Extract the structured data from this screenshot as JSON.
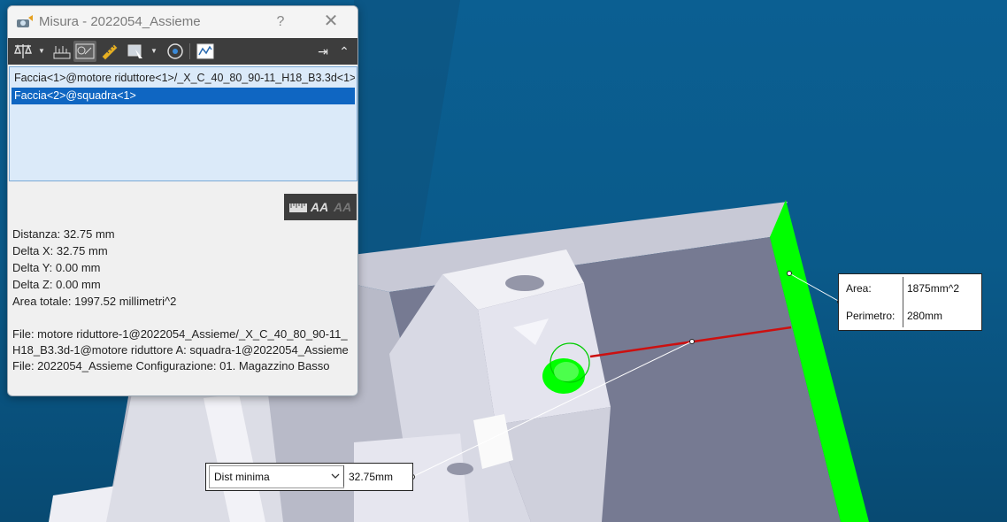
{
  "dialog": {
    "title": "Misura - 2022054_Assieme",
    "help_label": "?",
    "close_label": "✕"
  },
  "selections": [
    "Faccia<1>@motore riduttore<1>/_X_C_40_80_90-11_H18_B3.3d<1>",
    "Faccia<2>@squadra<1>"
  ],
  "results": {
    "distance": "Distanza: 32.75 mm",
    "delta_x": "Delta X: 32.75 mm",
    "delta_y": "Delta Y: 0.00 mm",
    "delta_z": "Delta Z: 0.00 mm",
    "total_area": "Area totale: 1997.52 millimetri^2"
  },
  "files": {
    "file_1": "File: motore riduttore-1@2022054_Assieme/_X_C_40_80_90-11_H18_B3.3d-1@motore riduttore A: squadra-1@2022054_Assieme",
    "file_2": "File: 2022054_Assieme Configurazione: 01. Magazzino Basso"
  },
  "area_callout": {
    "area_label": "Area:",
    "area_value": "1875mm^2",
    "perimeter_label": "Perimetro:",
    "perimeter_value": "280mm"
  },
  "distance_callout": {
    "mode": "Dist minima",
    "value": "32.75mm"
  },
  "colors": {
    "background": "#0a5c8c",
    "face_highlight": "#00ff00",
    "distance_line": "#cc1010",
    "selection_blue": "#0f66c2"
  }
}
